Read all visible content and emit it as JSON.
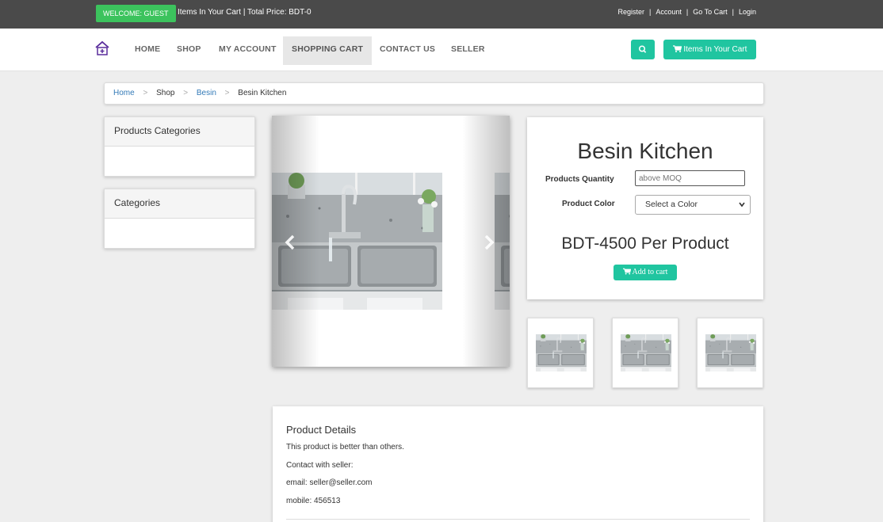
{
  "topbar": {
    "welcome": "WELCOME: GUEST",
    "cart_info": "Items In Your Cart | Total Price: BDT-0",
    "links": [
      "Register",
      "Account",
      "Go To Cart",
      "Login"
    ],
    "separator": "|"
  },
  "nav": {
    "items": [
      "HOME",
      "SHOP",
      "MY ACCOUNT",
      "SHOPPING CART",
      "CONTACT US",
      "SELLER"
    ],
    "active": "SHOPPING CART",
    "cart_button": "Items In Your Cart",
    "search_icon": "search-icon",
    "cart_icon": "cart-icon",
    "home_icon": "home-icon"
  },
  "breadcrumb": {
    "items": [
      "Home",
      "Shop",
      "Besin",
      "Besin Kitchen"
    ],
    "separator": ">"
  },
  "sidebar": {
    "panels": [
      "Products Categories",
      "Categories"
    ]
  },
  "product": {
    "title": "Besin Kitchen",
    "quantity_label": "Products Quantity",
    "quantity_placeholder": "above MOQ",
    "color_label": "Product Color",
    "color_selected": "Select a Color",
    "price": "BDT-4500 Per Product",
    "add_to_cart": "Add to cart"
  },
  "carousel": {
    "prev_icon": "chevron-left-icon",
    "next_icon": "chevron-right-icon"
  },
  "details": {
    "heading": "Product Details",
    "lines": [
      "This product is better than others.",
      "Contact with seller:",
      "email: seller@seller.com",
      "mobile: 456513"
    ]
  },
  "colors": {
    "accent": "#20c5a0",
    "welcome_badge": "#3cc35d",
    "topbar": "#4a4a4a",
    "link": "#337ab7"
  }
}
